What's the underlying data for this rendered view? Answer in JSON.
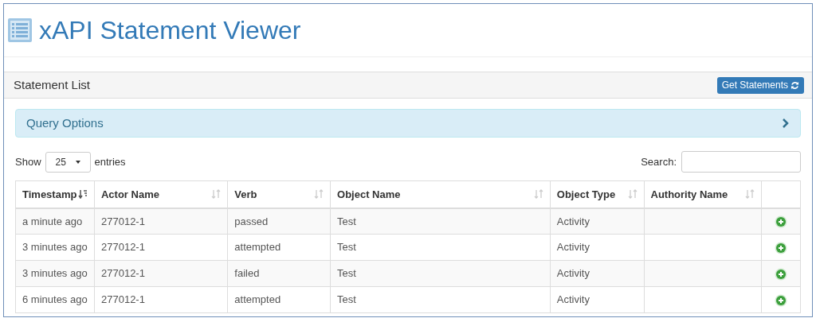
{
  "header": {
    "title": "xAPI Statement Viewer"
  },
  "panel": {
    "title": "Statement List",
    "button": "Get Statements"
  },
  "query_options": {
    "label": "Query Options",
    "expanded": false
  },
  "length": {
    "before": "Show",
    "value": "25",
    "after": "entries"
  },
  "search": {
    "label": "Search:"
  },
  "table": {
    "columns": [
      {
        "label": "Timestamp",
        "sorted": true
      },
      {
        "label": "Actor Name",
        "sorted": false
      },
      {
        "label": "Verb",
        "sorted": false
      },
      {
        "label": "Object Name",
        "sorted": false
      },
      {
        "label": "Object Type",
        "sorted": false
      },
      {
        "label": "Authority Name",
        "sorted": false
      }
    ],
    "rows": [
      {
        "cells": [
          "a minute ago",
          "277012-1",
          "passed",
          "Test",
          "Activity"
        ]
      },
      {
        "cells": [
          "3 minutes ago",
          "277012-1",
          "attempted",
          "Test",
          "Activity"
        ]
      },
      {
        "cells": [
          "3 minutes ago",
          "277012-1",
          "failed",
          "Test",
          "Activity"
        ]
      },
      {
        "cells": [
          "6 minutes ago",
          "277012-1",
          "attempted",
          "Test",
          "Activity"
        ]
      }
    ]
  }
}
